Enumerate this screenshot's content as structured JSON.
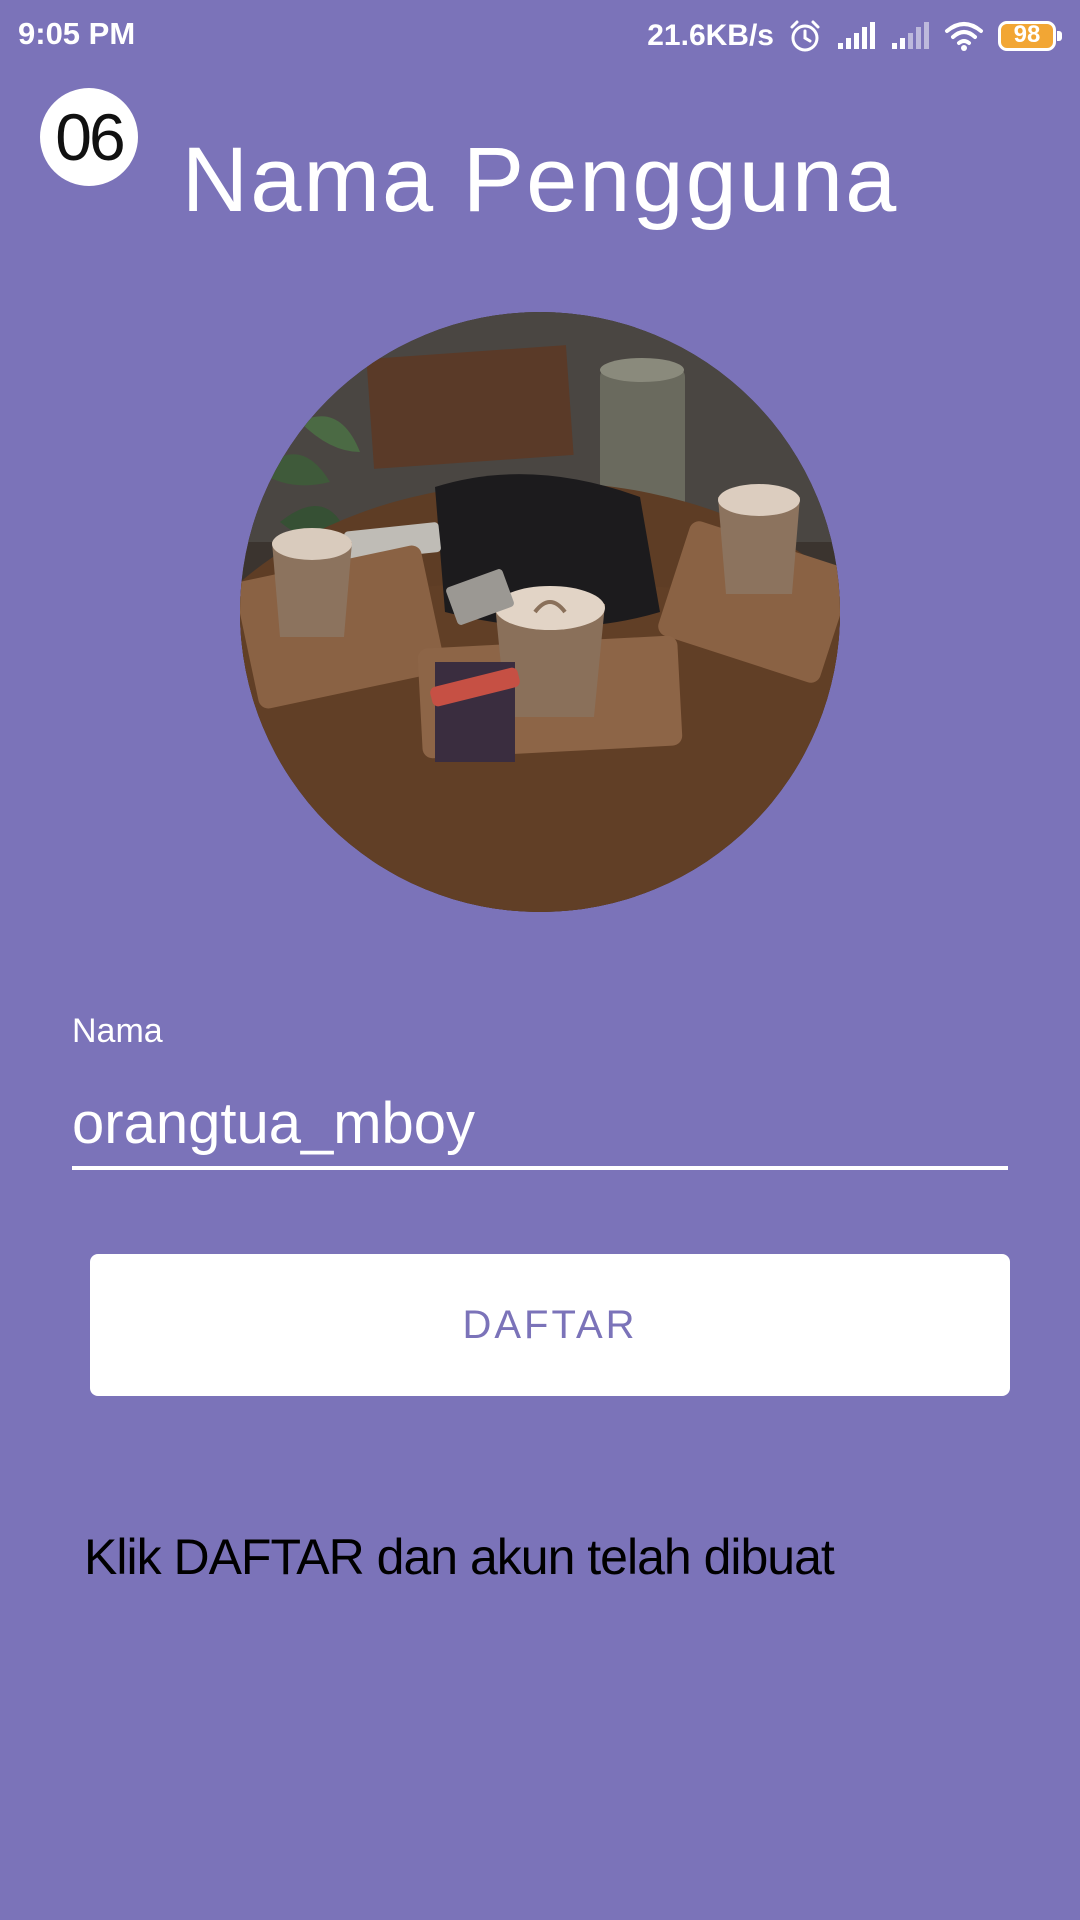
{
  "status_bar": {
    "time": "9:05 PM",
    "net_speed": "21.6KB/s",
    "battery_level": "98",
    "icons": [
      "alarm-icon",
      "signal-icon",
      "signal-weak-icon",
      "wifi-icon",
      "battery-icon"
    ]
  },
  "step_badge": "06",
  "title": "Nama Pengguna",
  "avatar": {
    "icon": "profile-photo"
  },
  "form": {
    "name_label": "Nama",
    "name_value": "orangtua_mboy"
  },
  "button": {
    "daftar_label": "DAFTAR"
  },
  "instruction": "Klik DAFTAR dan akun telah dibuat",
  "colors": {
    "background": "#7b73b9",
    "button_text": "#7b73b9",
    "battery": "#f2a634"
  }
}
